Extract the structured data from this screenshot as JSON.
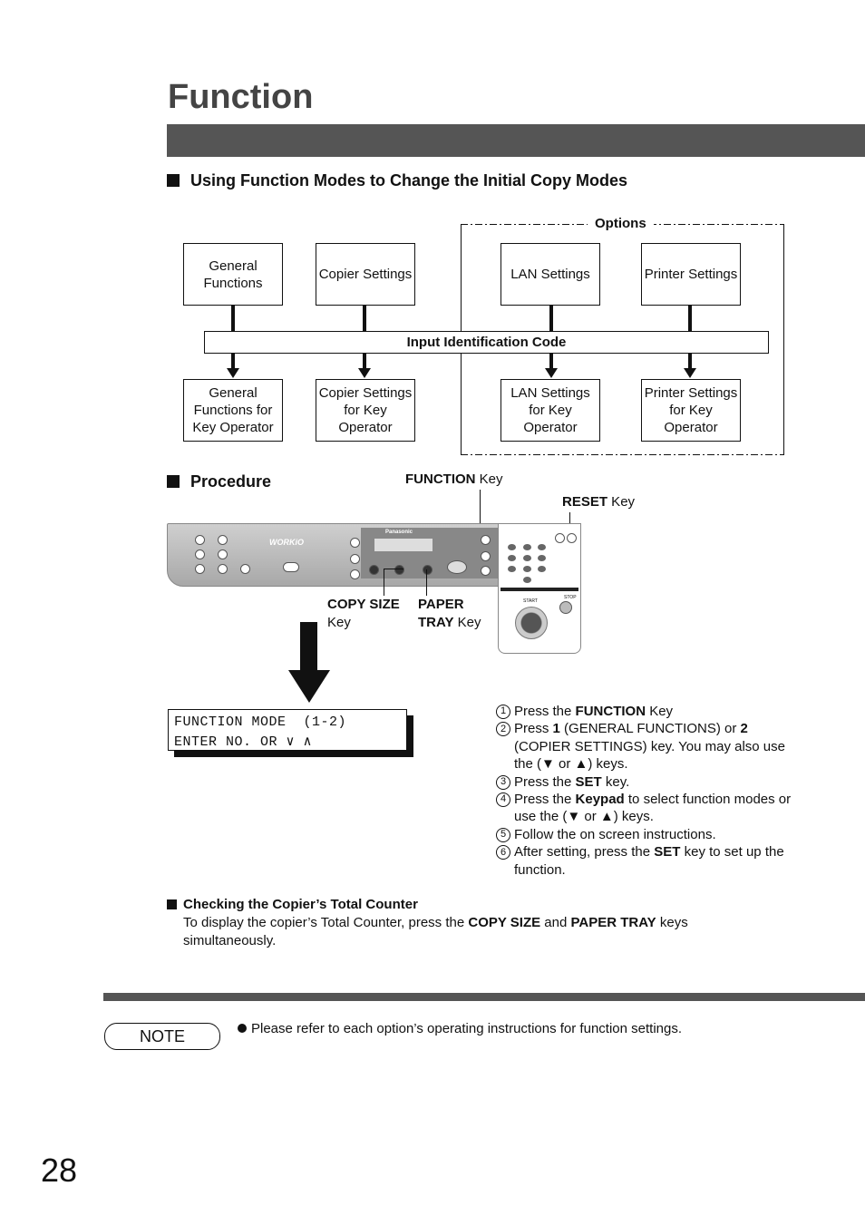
{
  "page": {
    "title": "Function",
    "page_number": "28"
  },
  "section1": {
    "heading": "Using Function Modes to Change the Initial Copy Modes",
    "options_label": "Options",
    "top_boxes": [
      "General Functions",
      "Copier Settings",
      "LAN Settings",
      "Printer Settings"
    ],
    "bar_label": "Input Identification Code",
    "bottom_boxes": [
      "General Functions for Key Operator",
      "Copier Settings for Key Operator",
      "LAN Settings for Key Operator",
      "Printer Settings for Key Operator"
    ]
  },
  "procedure": {
    "heading": "Procedure",
    "callouts": {
      "function_bold": "FUNCTION",
      "function_rest": " Key",
      "reset_bold": "RESET",
      "reset_rest": " Key",
      "copy_size_bold": "COPY SIZE",
      "copy_size_rest": "Key",
      "paper_bold": "PAPER",
      "paper_tray_bold": "TRAY",
      "paper_rest": " Key"
    },
    "panel_logos": [
      "WORKiO",
      "Panasonic"
    ],
    "pad_labels": {
      "start": "START",
      "stop": "STOP"
    },
    "lcd": {
      "line1": "FUNCTION MODE  (1-2)",
      "line2": "ENTER NO. OR ∨ ∧"
    },
    "steps": [
      {
        "n": "1",
        "parts": [
          [
            "Press the ",
            ""
          ],
          [
            "FUNCTION",
            "b"
          ],
          [
            " Key",
            ""
          ]
        ]
      },
      {
        "n": "2",
        "parts": [
          [
            "Press ",
            ""
          ],
          [
            "1",
            "b"
          ],
          [
            " (GENERAL FUNCTIONS) or ",
            ""
          ],
          [
            "2",
            "b"
          ],
          [
            " (COPIER SETTINGS) key. You may also use the (▼ or ▲) keys.",
            ""
          ]
        ]
      },
      {
        "n": "3",
        "parts": [
          [
            "Press the ",
            ""
          ],
          [
            "SET",
            "b"
          ],
          [
            " key.",
            ""
          ]
        ]
      },
      {
        "n": "4",
        "parts": [
          [
            "Press the ",
            ""
          ],
          [
            "Keypad",
            "b"
          ],
          [
            " to select function modes or use the (▼ or ▲) keys.",
            ""
          ]
        ]
      },
      {
        "n": "5",
        "parts": [
          [
            "Follow the on screen instructions.",
            ""
          ]
        ]
      },
      {
        "n": "6",
        "parts": [
          [
            "After setting, press the ",
            ""
          ],
          [
            "SET",
            "b"
          ],
          [
            " key to set up the function.",
            ""
          ]
        ]
      }
    ]
  },
  "counter": {
    "heading": "Checking the Copier’s Total Counter",
    "parts": [
      [
        "To display the copier’s Total Counter, press the ",
        ""
      ],
      [
        "COPY SIZE",
        "b"
      ],
      [
        " and ",
        ""
      ],
      [
        "PAPER TRAY",
        "b"
      ],
      [
        " keys simultaneously.",
        ""
      ]
    ]
  },
  "note": {
    "label": "NOTE",
    "text": "Please refer to each option’s operating instructions for function settings."
  }
}
